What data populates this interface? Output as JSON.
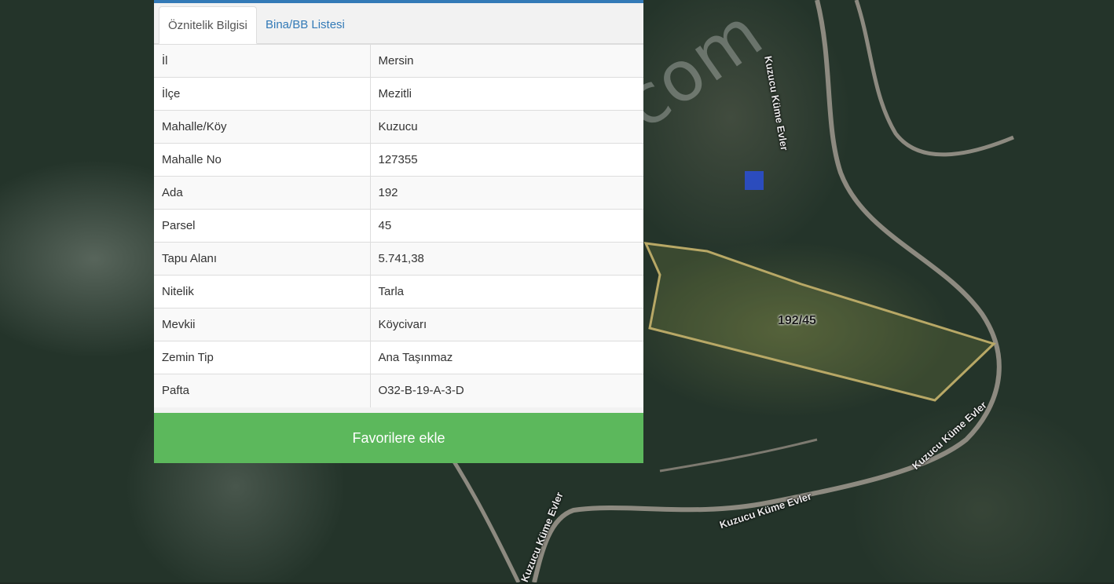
{
  "tabs": [
    {
      "label": "Öznitelik Bilgisi",
      "active": true
    },
    {
      "label": "Bina/BB Listesi",
      "active": false
    }
  ],
  "attributes": [
    {
      "key": "İl",
      "value": "Mersin"
    },
    {
      "key": "İlçe",
      "value": "Mezitli"
    },
    {
      "key": "Mahalle/Köy",
      "value": "Kuzucu"
    },
    {
      "key": "Mahalle No",
      "value": "127355"
    },
    {
      "key": "Ada",
      "value": "192"
    },
    {
      "key": "Parsel",
      "value": "45"
    },
    {
      "key": "Tapu Alanı",
      "value": "5.741,38"
    },
    {
      "key": "Nitelik",
      "value": "Tarla"
    },
    {
      "key": "Mevkii",
      "value": "Köycivarı"
    },
    {
      "key": "Zemin Tip",
      "value": "Ana Taşınmaz"
    },
    {
      "key": "Pafta",
      "value": "O32-B-19-A-3-D"
    }
  ],
  "favorite_button": "Favorilere ekle",
  "map": {
    "parcel_label": "192/45",
    "road_labels": [
      "Kuzucu Küme Evler",
      "Kuzucu Küme Evler",
      "Kuzucu Küme Evler",
      "Kuzucu Küme Evler"
    ],
    "watermark": "emlakjet.com"
  },
  "colors": {
    "accent": "#337ab7",
    "button": "#5cb85c",
    "parcel_outline": "#b8a866"
  }
}
